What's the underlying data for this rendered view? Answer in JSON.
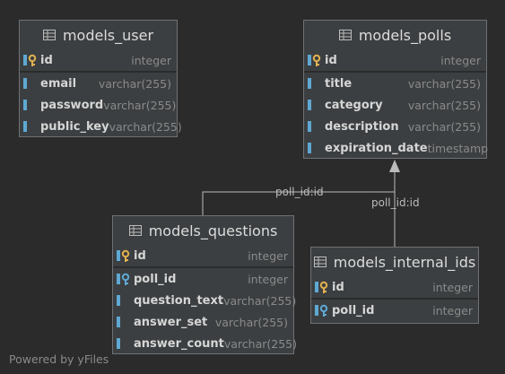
{
  "tables": {
    "user": {
      "name": "models_user",
      "columns": [
        {
          "name": "id",
          "type": "integer",
          "key": "pk"
        },
        {
          "name": "email",
          "type": "varchar(255)",
          "key": "col"
        },
        {
          "name": "password",
          "type": "varchar(255)",
          "key": "col"
        },
        {
          "name": "public_key",
          "type": "varchar(255)",
          "key": "col"
        }
      ]
    },
    "polls": {
      "name": "models_polls",
      "columns": [
        {
          "name": "id",
          "type": "integer",
          "key": "pk"
        },
        {
          "name": "title",
          "type": "varchar(255)",
          "key": "col"
        },
        {
          "name": "category",
          "type": "varchar(255)",
          "key": "col"
        },
        {
          "name": "description",
          "type": "varchar(255)",
          "key": "col"
        },
        {
          "name": "expiration_date",
          "type": "timestamp",
          "key": "col"
        }
      ]
    },
    "questions": {
      "name": "models_questions",
      "columns": [
        {
          "name": "id",
          "type": "integer",
          "key": "pk"
        },
        {
          "name": "poll_id",
          "type": "integer",
          "key": "fk"
        },
        {
          "name": "question_text",
          "type": "varchar(255)",
          "key": "col"
        },
        {
          "name": "answer_set",
          "type": "varchar(255)",
          "key": "col"
        },
        {
          "name": "answer_count",
          "type": "varchar(255)",
          "key": "col"
        }
      ]
    },
    "internal_ids": {
      "name": "models_internal_ids",
      "columns": [
        {
          "name": "id",
          "type": "integer",
          "key": "pk"
        },
        {
          "name": "poll_id",
          "type": "integer",
          "key": "fk"
        }
      ]
    }
  },
  "edges": [
    {
      "label": "poll_id:id"
    },
    {
      "label": "poll_id:id"
    }
  ],
  "footer": "Powered by yFiles",
  "colors": {
    "background": "#2b2b2b",
    "table": "#3c3f41",
    "edge": "#bbbbbb",
    "pk": "#e0b050",
    "fk": "#5fa8d3"
  }
}
